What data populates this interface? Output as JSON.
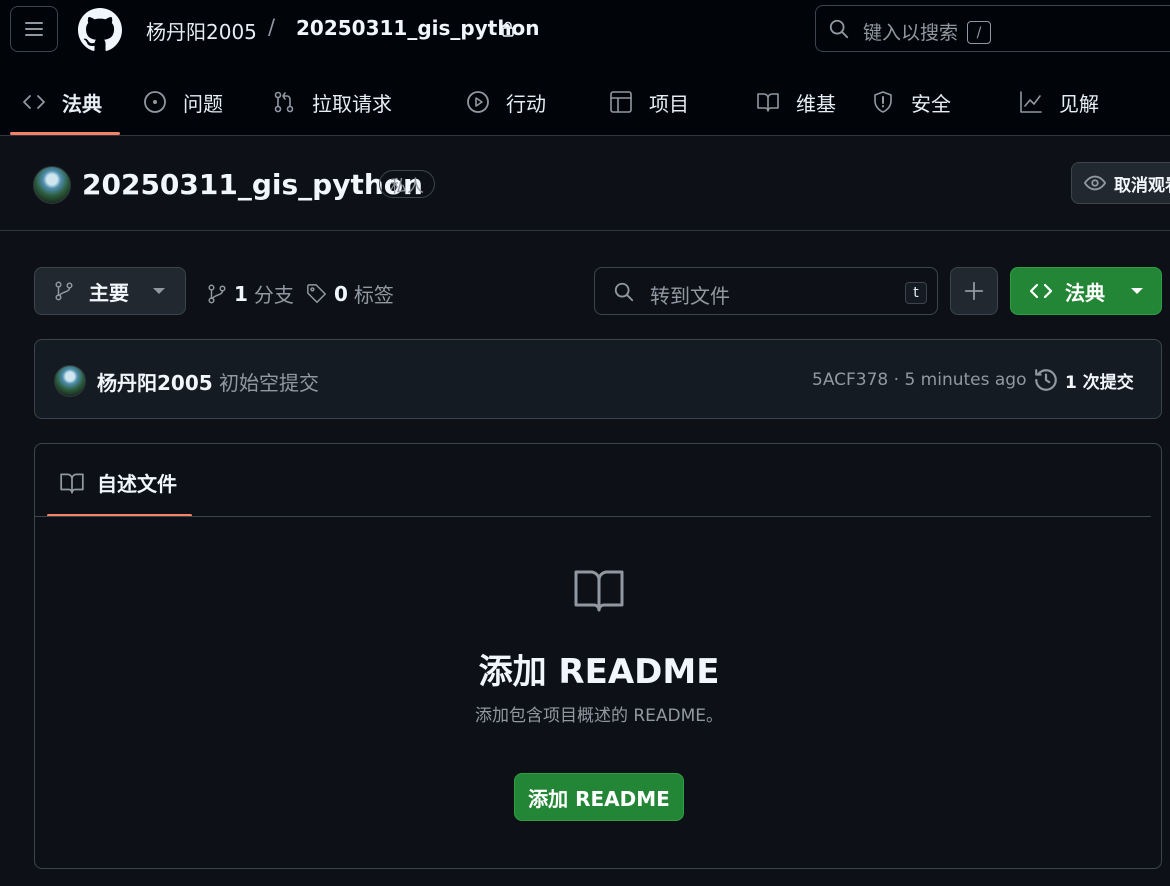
{
  "header": {
    "owner": "杨丹阳2005",
    "separator": "/",
    "repo": "20250311_gis_python",
    "search_placeholder": "键入以搜索",
    "search_shortcut": "/"
  },
  "nav": {
    "tabs": [
      {
        "label": "法典",
        "icon": "code-icon"
      },
      {
        "label": "问题",
        "icon": "issue-icon"
      },
      {
        "label": "拉取请求",
        "icon": "pull-request-icon"
      },
      {
        "label": "行动",
        "icon": "play-icon"
      },
      {
        "label": "项目",
        "icon": "table-icon"
      },
      {
        "label": "维基",
        "icon": "book-icon"
      },
      {
        "label": "安全",
        "icon": "shield-icon"
      },
      {
        "label": "见解",
        "icon": "graph-icon"
      }
    ]
  },
  "repo_header": {
    "title": "20250311_gis_python",
    "visibility": "私人",
    "unwatch_label": "取消观看"
  },
  "toolbar": {
    "branch_name": "主要",
    "branches_count": "1",
    "branches_label": "分支",
    "tags_count": "0",
    "tags_label": "标签",
    "file_search_placeholder": "转到文件",
    "file_search_shortcut": "t",
    "code_label": "法典"
  },
  "commit": {
    "author": "杨丹阳2005",
    "message": "初始空提交",
    "sha_time": "5ACF378 · 5 minutes ago",
    "count_label": "1 次提交"
  },
  "readme": {
    "tab_label": "自述文件",
    "heading": "添加 README",
    "subtitle": "添加包含项目概述的 README。",
    "button_label": "添加 README"
  },
  "colors": {
    "background": "#0d1117",
    "header_bg": "#010409",
    "accent_underline": "#f78166",
    "primary_button": "#238636"
  }
}
